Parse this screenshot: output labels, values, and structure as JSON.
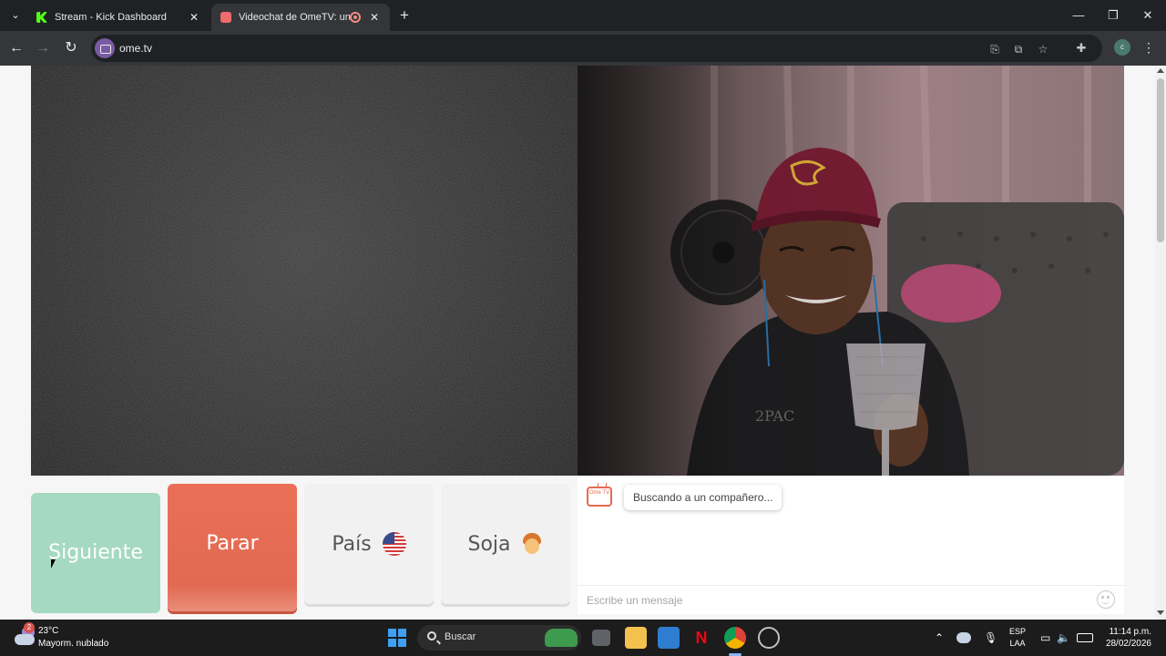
{
  "browser": {
    "tabs": [
      {
        "title": "Stream - Kick Dashboard",
        "icon": "kick-icon",
        "active": false
      },
      {
        "title": "Videochat de OmeTV: una alternativa",
        "icon": "ometv-icon",
        "active": true
      }
    ],
    "url": "ome.tv"
  },
  "main": {
    "buttons": {
      "next": "Siguiente",
      "stop": "Parar",
      "country": "País",
      "gender": "Soja"
    },
    "country_flag": "us-flag-icon",
    "gender_icon": "boy-icon"
  },
  "chat": {
    "logo": "Ome TV",
    "status": "Buscando a un compañero...",
    "input_placeholder": "Escribe un mensaje"
  },
  "taskbar": {
    "weather_badge": "2",
    "temperature": "23°C",
    "forecast": "Mayorm. nublado",
    "search_label": "Buscar",
    "language": "ESP",
    "layout": "LAA",
    "time": "11:14 p.m.",
    "date": "28/02/2026"
  },
  "colors": {
    "next_button": "#a5d9c1",
    "stop_button": "#e26a52",
    "neutral_button": "#f1f1f1",
    "accent": "#e36b52"
  }
}
